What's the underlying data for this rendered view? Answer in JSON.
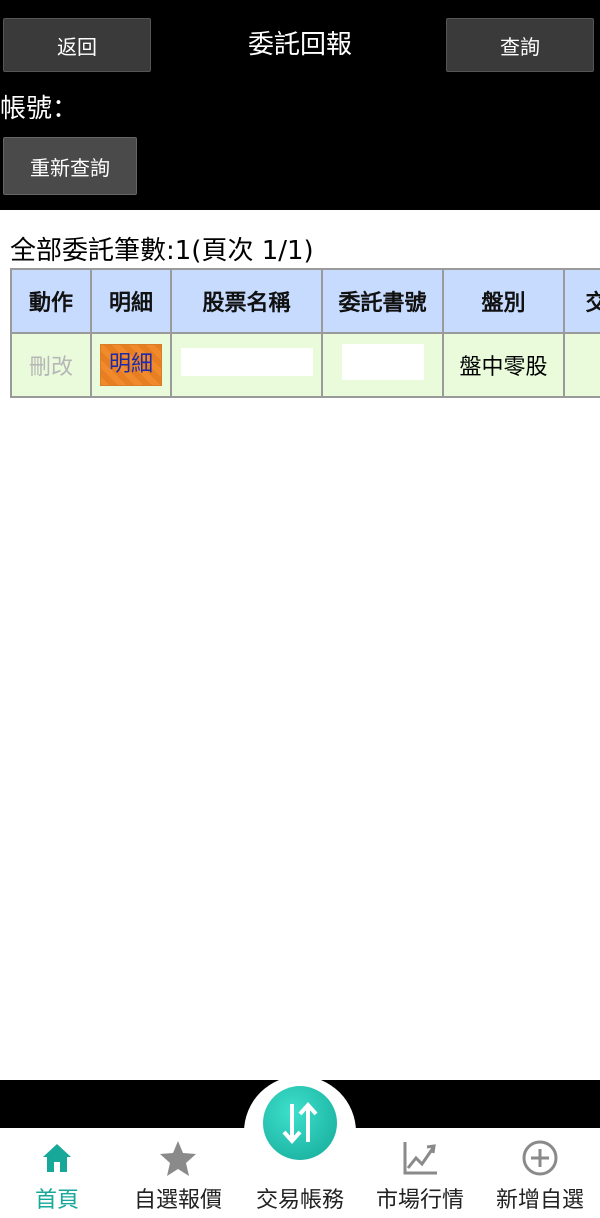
{
  "header": {
    "back_label": "返回",
    "title": "委託回報",
    "query_label": "查詢",
    "account_label": "帳號：",
    "requery_label": "重新查詢"
  },
  "summary": "全部委託筆數:1(頁次 1/1)",
  "table": {
    "columns": [
      "動作",
      "明細",
      "股票名稱",
      "委託書號",
      "盤別",
      "交易"
    ],
    "rows": [
      {
        "action": "刪改",
        "detail": "明細",
        "stock_name": "",
        "order_no": "",
        "session": "盤中零股",
        "trade": ""
      }
    ]
  },
  "bottom_nav": {
    "items": [
      {
        "label": "首頁",
        "icon": "home-icon"
      },
      {
        "label": "自選報價",
        "icon": "star-icon"
      },
      {
        "label": "交易帳務",
        "icon": "trade-arrows-icon"
      },
      {
        "label": "市場行情",
        "icon": "chart-icon"
      },
      {
        "label": "新增自選",
        "icon": "plus-circle-icon"
      }
    ]
  },
  "colors": {
    "header_bg": "#000000",
    "table_header_bg": "#c7dbff",
    "table_row_bg": "#e9fbdb",
    "accent": "#17a89a"
  }
}
